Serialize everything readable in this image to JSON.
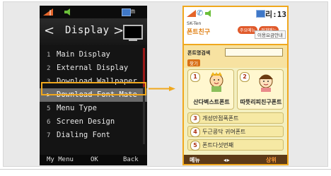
{
  "left_phone": {
    "status_right": "m",
    "header": {
      "title": "Display",
      "arrow_left": "<",
      "arrow_right": ">"
    },
    "menu": [
      {
        "num": "1",
        "label": "Main Display",
        "selected": false
      },
      {
        "num": "2",
        "label": "External Display",
        "selected": false
      },
      {
        "num": "3",
        "label": "Download Wallpaper",
        "selected": false
      },
      {
        "num": ">",
        "label": "Download Font Mate",
        "selected": true
      },
      {
        "num": "5",
        "label": "Menu Type",
        "selected": false
      },
      {
        "num": "6",
        "label": "Screen Design",
        "selected": false
      },
      {
        "num": "7",
        "label": "Dialing Font",
        "selected": false
      }
    ],
    "softkeys": {
      "left": "My Menu",
      "center": "OK",
      "right": "Back"
    }
  },
  "right_phone": {
    "time": "리:13",
    "header": {
      "subtitle": "SK-Ten",
      "title": "폰트친구",
      "buttons": [
        "주요메뉴",
        "전체메뉴"
      ],
      "help": "이용요금안내"
    },
    "search": {
      "label": "폰트명검색",
      "button": "찾기",
      "value": ""
    },
    "cards": [
      {
        "num": "1",
        "name": "산다벽스트폰트"
      },
      {
        "num": "2",
        "name": "따뜻리피친구폰트"
      }
    ],
    "list": [
      {
        "num": "3",
        "name": "개성만점폭폰트"
      },
      {
        "num": "4",
        "name": "두근콩닥 귀여폰트"
      },
      {
        "num": "5",
        "name": "폰트다섯번째"
      }
    ],
    "softkeys": {
      "left": "메뉴",
      "center": "◂ ▸",
      "right": "상위"
    }
  },
  "colors": {
    "highlight": "#f0a81e",
    "screen_bg": "#141414",
    "right_bg": "#f3efc0"
  }
}
